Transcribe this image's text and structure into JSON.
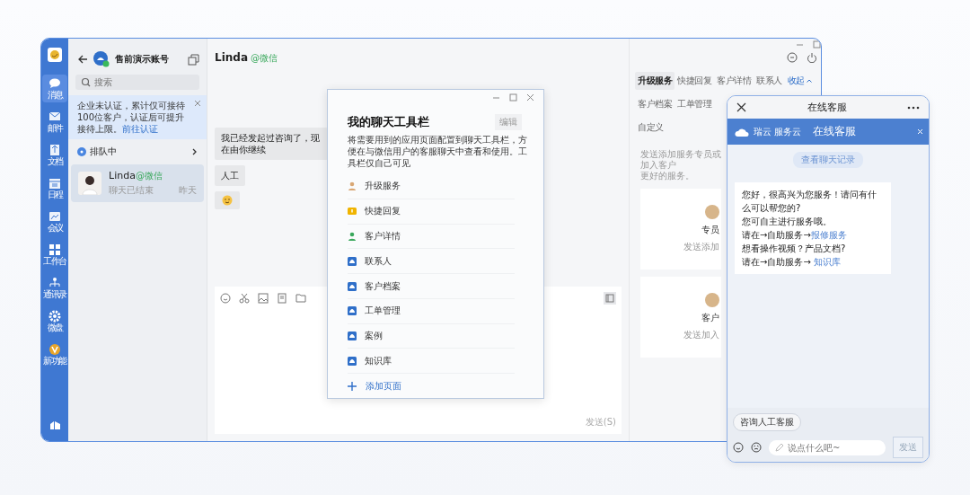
{
  "nav": {
    "items": [
      {
        "label": "消息",
        "selected": true
      },
      {
        "label": "邮件",
        "selected": false
      },
      {
        "label": "文档",
        "selected": false
      },
      {
        "label": "日程",
        "selected": false
      },
      {
        "label": "会议",
        "selected": false
      },
      {
        "label": "工作台",
        "selected": false
      },
      {
        "label": "通讯录",
        "selected": false
      },
      {
        "label": "微盘",
        "selected": false
      },
      {
        "label": "新功能",
        "selected": false
      }
    ]
  },
  "account": {
    "name": "售前演示账号"
  },
  "search": {
    "placeholder": "搜索"
  },
  "notice": {
    "text": "企业未认证，累计仅可接待100位客户，认证后可提升接待上限。",
    "link": "前往认证"
  },
  "queue": {
    "label": "排队中"
  },
  "conversations": [
    {
      "name": "Linda",
      "channel": "@微信",
      "preview": "聊天已结束",
      "time": "昨天",
      "selected": true
    }
  ],
  "chat": {
    "title": "Linda",
    "channel": "@微信",
    "messages": [
      {
        "kind": "text",
        "text": "我已经发起过咨询了，现在由你继续"
      },
      {
        "kind": "text",
        "text": "人工"
      },
      {
        "kind": "emoji"
      }
    ],
    "send": "发送(S)"
  },
  "side_panel": {
    "tabs": [
      {
        "label": "升级服务",
        "selected": true
      },
      {
        "label": "快捷回复",
        "selected": false
      },
      {
        "label": "客户详情",
        "selected": false
      },
      {
        "label": "联系人",
        "selected": false
      },
      {
        "label": "客户档案",
        "selected": false
      },
      {
        "label": "工单管理",
        "selected": false
      },
      {
        "label": "自定义",
        "selected": false
      }
    ],
    "collapse": "收起",
    "description": [
      "发送添加服务专员或加入客户",
      "更好的服务。"
    ],
    "cards": [
      {
        "title": "专员",
        "text": "发送添加"
      },
      {
        "title": "客户",
        "text": "发送加入"
      }
    ]
  },
  "toolbar_dialog": {
    "title": "我的聊天工具栏",
    "edit": "编辑",
    "description": "将需要用到的应用页面配置到聊天工具栏，方便在与微信用户的客服聊天中查看和使用。工具栏仅自己可见",
    "items": [
      "升级服务",
      "快捷回复",
      "客户详情",
      "联系人",
      "客户档案",
      "工单管理",
      "案例",
      "知识库"
    ],
    "add": "添加页面"
  },
  "cs_window": {
    "title": "在线客服",
    "brand": "瑞云 服务云",
    "banner_title": "在线客服",
    "history": "查看聊天记录",
    "message": [
      {
        "text": "您好，很高兴为您服务！请问有什么可以帮您的?"
      },
      {
        "text": "您可自主进行服务哦。"
      },
      {
        "text": "请在→自助服务→",
        "link": "报修服务"
      },
      {
        "text": "想看操作视频？产品文档?"
      },
      {
        "text": "请在→自助服务→ ",
        "link": "知识库"
      }
    ],
    "quick_reply": "咨询人工客服",
    "placeholder": "说点什么吧~",
    "send": "发送"
  }
}
